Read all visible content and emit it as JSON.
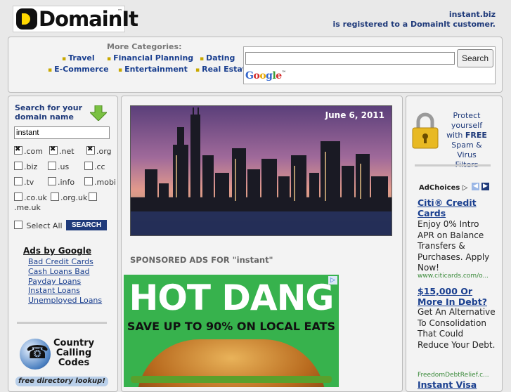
{
  "header": {
    "logo_text": "DomainIt",
    "logo_tm": "™",
    "domain": "instant.biz",
    "registered_text": "is registered to a DomainIt customer."
  },
  "categories": {
    "label": "More Categories:",
    "row1": [
      "Travel",
      "Financial Planning",
      "Dating"
    ],
    "row2": [
      "E-Commerce",
      "Entertainment",
      "Real Estate"
    ]
  },
  "google_search": {
    "query": "",
    "button_label": "Search",
    "logo_text": "Google"
  },
  "domain_search": {
    "title": "Search for your domain name",
    "query": "instant",
    "tlds": [
      {
        "label": ".com",
        "checked": true
      },
      {
        "label": ".net",
        "checked": true
      },
      {
        "label": ".org",
        "checked": true
      },
      {
        "label": ".biz",
        "checked": false
      },
      {
        "label": ".us",
        "checked": false
      },
      {
        "label": ".cc",
        "checked": false
      },
      {
        "label": ".tv",
        "checked": false
      },
      {
        "label": ".info",
        "checked": false
      },
      {
        "label": ".mobi",
        "checked": false
      },
      {
        "label": ".co.uk",
        "checked": false
      },
      {
        "label": ".org.uk",
        "checked": false
      },
      {
        "label": ".me.uk",
        "checked": false
      }
    ],
    "select_all_label": "Select All",
    "search_button": "SEARCH"
  },
  "ads_by_google": {
    "title": "Ads by Google",
    "links": [
      "Bad Credit Cards",
      "Cash Loans Bad",
      "Payday Loans",
      "Instant Loans",
      "Unemployed Loans"
    ]
  },
  "calling_codes": {
    "line1": "Country",
    "line2": "Calling",
    "line3": "Codes",
    "banner": "free directory lookup!"
  },
  "hero": {
    "date": "June 6, 2011"
  },
  "sponsored": {
    "label": "SPONSORED ADS FOR \"instant\""
  },
  "hot_dang_ad": {
    "title": "HOT DANG",
    "subtitle": "SAVE UP TO 90% ON LOCAL EATS",
    "badge": "▷"
  },
  "right_promo": {
    "line1": "Protect yourself",
    "line2": "with",
    "free": "FREE",
    "line3": "Spam & Virus",
    "line4": "Filters"
  },
  "right_ads": {
    "adchoices_label": "AdChoices ▷",
    "ads": [
      {
        "title": "Citi® Credit Cards",
        "body": "Enjoy 0% Intro APR on Balance Transfers & Purchases. Apply Now!",
        "url": "www.citicards.com/o..."
      },
      {
        "title": "$15,000 Or More In Debt?",
        "body": "Get An Alternative To Consolidation That Could Reduce Your Debt.",
        "url": "FreedomDebtRelief.c..."
      },
      {
        "title": "Instant Visa",
        "body": "",
        "url": ""
      }
    ]
  },
  "colors": {
    "brand_blue": "#1f3a7a",
    "link_blue": "#1a3f8f",
    "accent_yellow": "#ffd800",
    "hot_dang_green": "#37b24d"
  }
}
